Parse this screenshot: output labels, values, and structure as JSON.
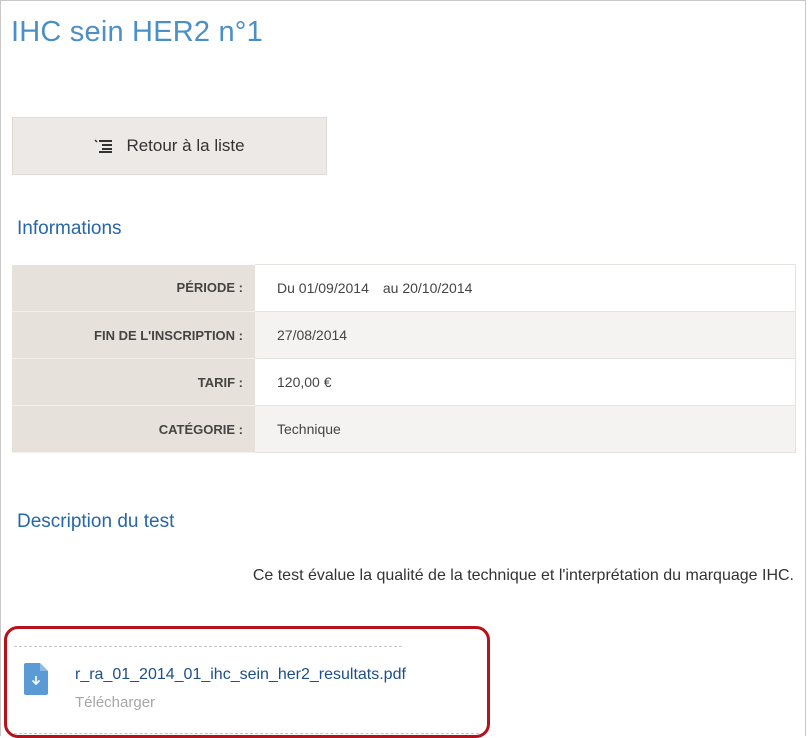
{
  "page": {
    "title": "IHC sein HER2 n°1"
  },
  "back_button": {
    "label": "Retour à la liste",
    "icon": "list-back-icon"
  },
  "informations": {
    "heading": "Informations",
    "rows": [
      {
        "label": "PÉRIODE :",
        "value": "Du 01/09/2014",
        "value_to": "au 20/10/2014"
      },
      {
        "label": "FIN DE L'INSCRIPTION :",
        "value": "27/08/2014"
      },
      {
        "label": "TARIF :",
        "value": "120,00 €"
      },
      {
        "label": "CATÉGORIE :",
        "value": "Technique"
      }
    ]
  },
  "description": {
    "heading": "Description du test",
    "text": "Ce test évalue la qualité de la technique et l'interprétation du marquage IHC."
  },
  "attachment": {
    "filename": "r_ra_01_2014_01_ihc_sein_her2_resultats.pdf",
    "download_label": "Télécharger",
    "icon": "file-download-icon"
  },
  "colors": {
    "title_blue": "#4a90c7",
    "heading_blue": "#2766a7",
    "highlight_red": "#b5121b",
    "file_icon_blue": "#5b9bd5"
  }
}
